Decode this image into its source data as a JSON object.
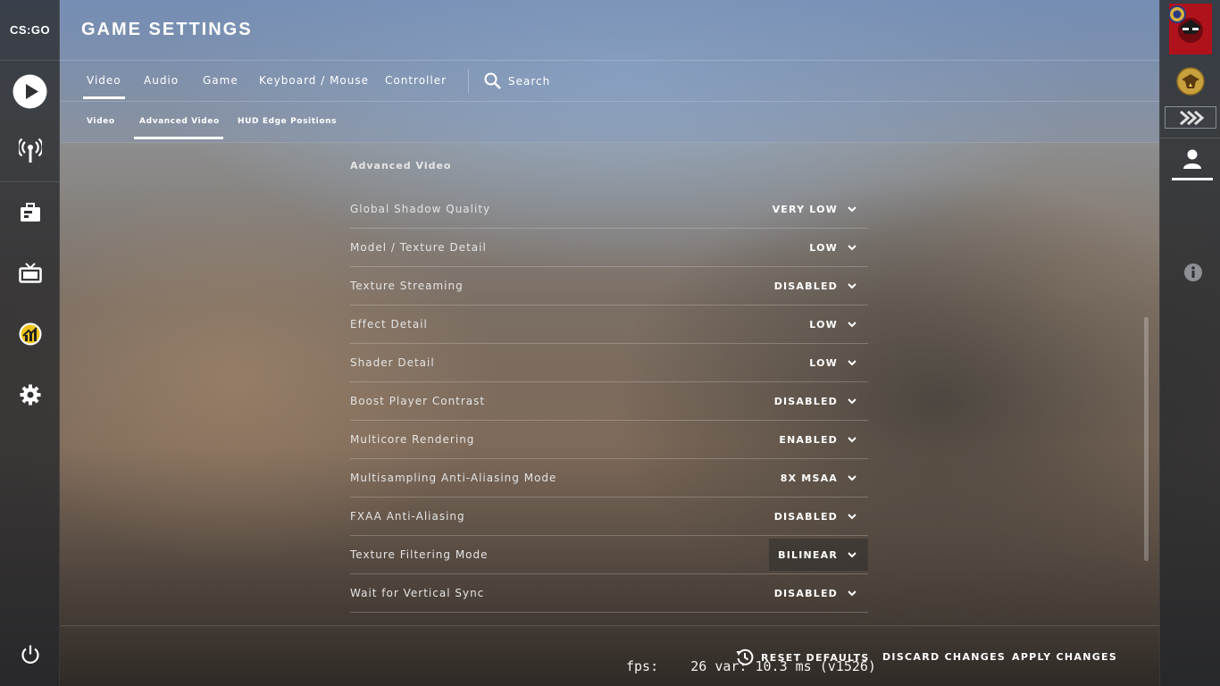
{
  "app": {
    "logo_text": "CS:GO"
  },
  "header": {
    "title": "GAME SETTINGS",
    "tabs": [
      {
        "label": "Video"
      },
      {
        "label": "Audio"
      },
      {
        "label": "Game"
      },
      {
        "label": "Keyboard / Mouse"
      },
      {
        "label": "Controller"
      }
    ],
    "search_label": "Search",
    "subtabs": [
      {
        "label": "Video"
      },
      {
        "label": "Advanced Video"
      },
      {
        "label": "HUD Edge Positions"
      }
    ]
  },
  "section": {
    "title": "Advanced Video",
    "settings": [
      {
        "label": "Global Shadow Quality",
        "value": "VERY LOW"
      },
      {
        "label": "Model / Texture Detail",
        "value": "LOW"
      },
      {
        "label": "Texture Streaming",
        "value": "DISABLED"
      },
      {
        "label": "Effect Detail",
        "value": "LOW"
      },
      {
        "label": "Shader Detail",
        "value": "LOW"
      },
      {
        "label": "Boost Player Contrast",
        "value": "DISABLED"
      },
      {
        "label": "Multicore Rendering",
        "value": "ENABLED"
      },
      {
        "label": "Multisampling Anti-Aliasing Mode",
        "value": "8X MSAA"
      },
      {
        "label": "FXAA Anti-Aliasing",
        "value": "DISABLED"
      },
      {
        "label": "Texture Filtering Mode",
        "value": "BILINEAR"
      },
      {
        "label": "Wait for Vertical Sync",
        "value": "DISABLED"
      }
    ]
  },
  "footer": {
    "reset_label": "RESET DEFAULTS",
    "discard_label": "DISCARD CHANGES",
    "apply_label": "APPLY CHANGES"
  },
  "overlay": {
    "fps_text": "fps:    26 var: 10.3 ms (v1526)"
  },
  "icons": {
    "left": [
      "play-icon",
      "broadcast-icon",
      "inventory-icon",
      "tv-icon",
      "stats-icon",
      "gear-icon",
      "power-icon"
    ],
    "right": [
      "avatar-icon",
      "rank-badge-icon",
      "rank-chevron-icon",
      "friends-icon",
      "info-icon"
    ]
  },
  "colors": {
    "accent": "#ffffff",
    "avatar_red": "#c8141e",
    "badge_gold": "#c8a03c"
  }
}
